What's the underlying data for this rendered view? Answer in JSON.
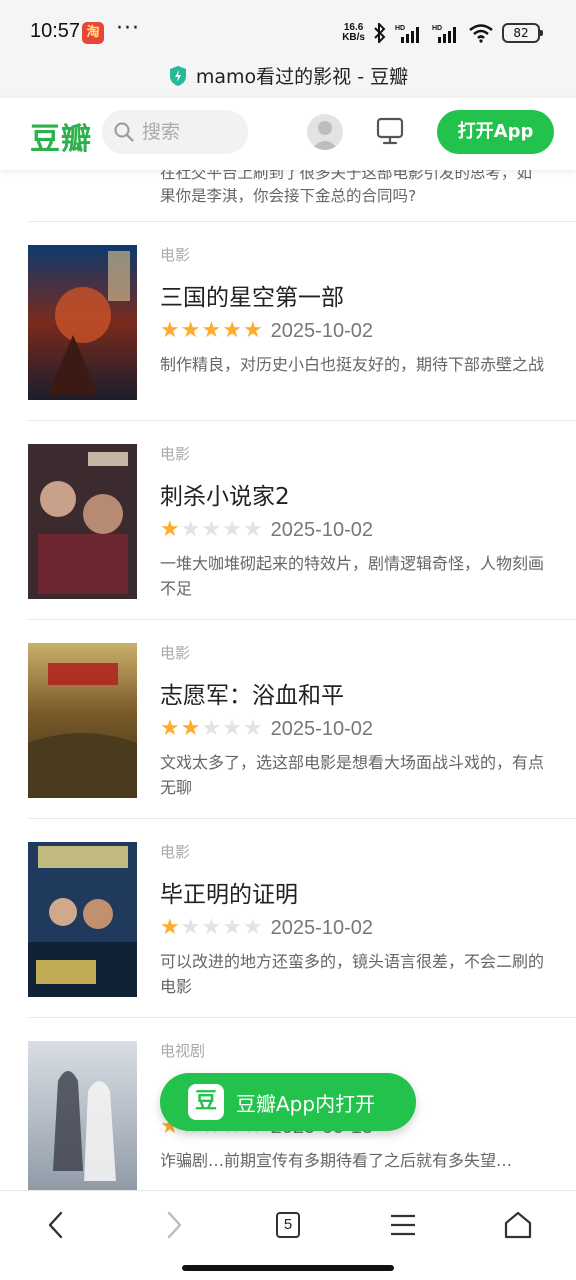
{
  "status_bar": {
    "time": "10:57",
    "app_badge": "淘",
    "dots": "···",
    "speed_value": "16.6",
    "speed_unit": "KB/s",
    "battery": "82"
  },
  "browser": {
    "page_title": "mamo看过的影视 - 豆瓣",
    "tab_count": "5"
  },
  "header": {
    "logo": "豆瓣",
    "search_placeholder": "搜索",
    "open_app_label": "打开App"
  },
  "top_snippet": "在社交平台上刷到了很多关于这部电影引发的思考，如果你是李淇，你会接下金总的合同吗?",
  "items": [
    {
      "category": "电影",
      "title": "三国的星空第一部",
      "stars": 5,
      "date": "2025-10-02",
      "comment": "制作精良，对历史小白也挺友好的，期待下部赤壁之战"
    },
    {
      "category": "电影",
      "title": "刺杀小说家2",
      "stars": 1,
      "date": "2025-10-02",
      "comment": "一堆大咖堆砌起来的特效片，剧情逻辑奇怪，人物刻画不足"
    },
    {
      "category": "电影",
      "title": "志愿军：浴血和平",
      "stars": 2,
      "date": "2025-10-02",
      "comment": "文戏太多了，选这部电影是想看大场面战斗戏的，有点无聊"
    },
    {
      "category": "电影",
      "title": "毕正明的证明",
      "stars": 1,
      "date": "2025-10-02",
      "comment": "可以改进的地方还蛮多的，镜头语言很差，不会二刷的电影"
    },
    {
      "category": "电视剧",
      "title": "",
      "stars": 1,
      "date": "2025-09-13",
      "comment": "诈骗剧…前期宣传有多期待看了之后就有多失望…"
    }
  ],
  "float_button": {
    "logo": "豆",
    "label": "豆瓣App内打开"
  },
  "colors": {
    "brand_green": "#22c24c",
    "star_on": "#ffac2d",
    "star_off": "#e3e3e3"
  },
  "icons": [
    "back-icon",
    "forward-icon",
    "tabs-icon",
    "menu-icon",
    "home-icon",
    "search-icon",
    "monitor-icon",
    "shield-icon",
    "bluetooth-icon",
    "signal-icon",
    "wifi-icon"
  ]
}
